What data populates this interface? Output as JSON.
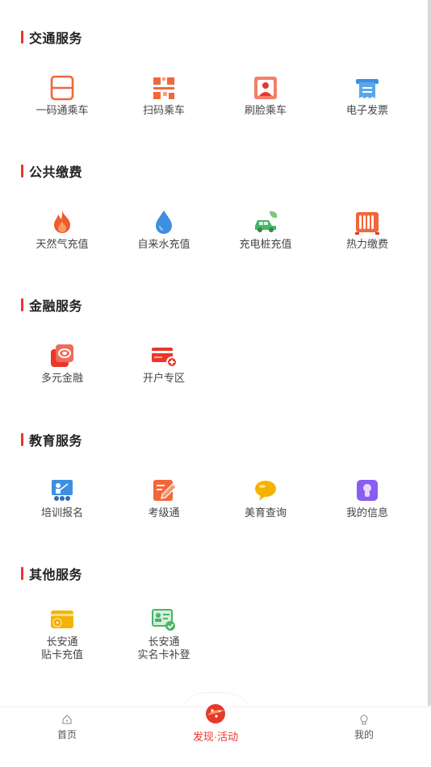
{
  "sections": [
    {
      "title": "交通服务",
      "items": [
        {
          "label": "一码通乘车",
          "icon": "qr-ride-icon"
        },
        {
          "label": "扫码乘车",
          "icon": "scan-qr-icon"
        },
        {
          "label": "刷脸乘车",
          "icon": "face-scan-icon"
        },
        {
          "label": "电子发票",
          "icon": "invoice-icon"
        }
      ]
    },
    {
      "title": "公共缴费",
      "items": [
        {
          "label": "天然气充值",
          "icon": "flame-icon"
        },
        {
          "label": "自来水充值",
          "icon": "water-drop-icon"
        },
        {
          "label": "充电桩充值",
          "icon": "ev-car-icon"
        },
        {
          "label": "热力缴费",
          "icon": "radiator-icon"
        }
      ]
    },
    {
      "title": "金融服务",
      "items": [
        {
          "label": "多元金融",
          "icon": "finance-icon"
        },
        {
          "label": "开户专区",
          "icon": "add-card-icon"
        }
      ]
    },
    {
      "title": "教育服务",
      "items": [
        {
          "label": "培训报名",
          "icon": "training-board-icon"
        },
        {
          "label": "考级通",
          "icon": "exam-pen-icon"
        },
        {
          "label": "美育查询",
          "icon": "chat-bubble-icon"
        },
        {
          "label": "我的信息",
          "icon": "profile-icon"
        }
      ]
    },
    {
      "title": "其他服务",
      "items": [
        {
          "label": "长安通",
          "label2": "贴卡充值",
          "icon": "card-recharge-icon"
        },
        {
          "label": "长安通",
          "label2": "实名卡补登",
          "icon": "id-card-check-icon"
        }
      ]
    }
  ],
  "tabbar": {
    "home": "首页",
    "discover": "发现·活动",
    "mine": "我的"
  },
  "colors": {
    "accent": "#e8382b",
    "orange": "#f2673a",
    "blue": "#3d8fe0",
    "green": "#4bb36a",
    "yellow": "#f5b300",
    "purple": "#8a5cf0"
  }
}
